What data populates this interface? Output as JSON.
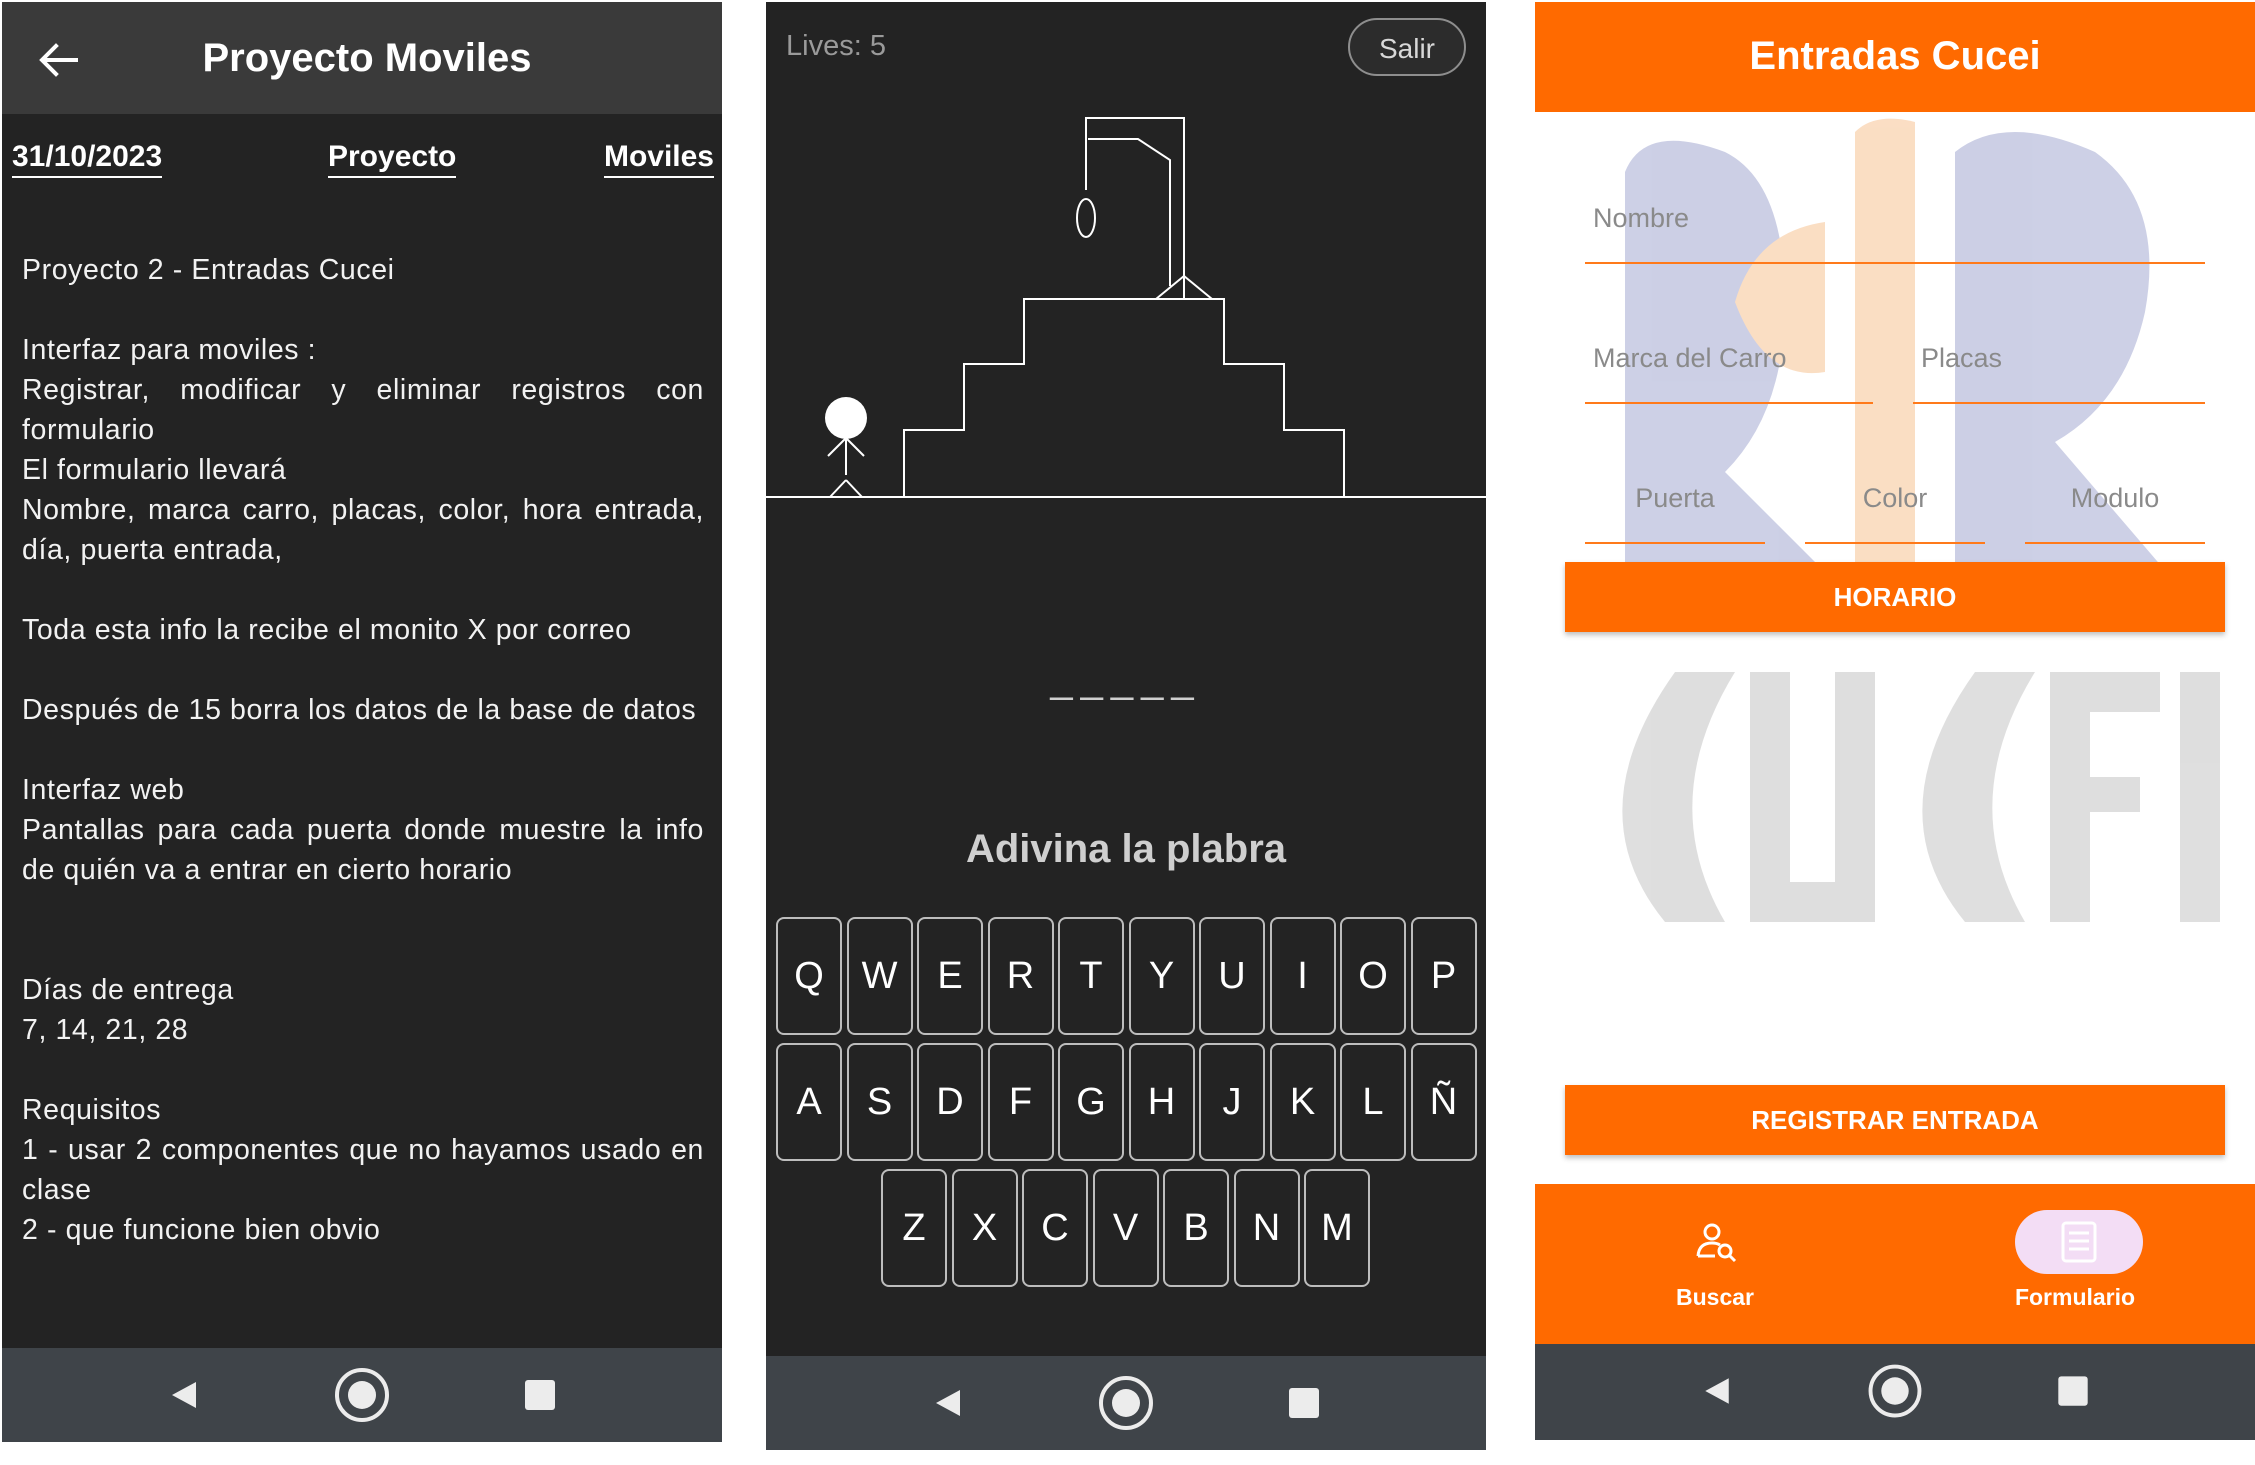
{
  "screen1": {
    "title": "Proyecto Moviles",
    "tabs": [
      "31/10/2023",
      "Proyecto",
      "Moviles"
    ],
    "body": {
      "l1": "Proyecto 2 - Entradas Cucei",
      "l2": "Interfaz para moviles :",
      "l3": "Registrar, modificar y eliminar registros con formulario",
      "l4": "El formulario llevará",
      "l5": "Nombre, marca carro, placas, color, hora entrada, día, puerta entrada,",
      "l6": "Toda esta info la recibe el monito X por correo",
      "l7": "Después de 15 borra los datos de la base de datos",
      "l8": "Interfaz web",
      "l9": "Pantallas para cada puerta donde muestre la info de quién va a entrar en cierto horario",
      "l10": "Días de entrega",
      "l11": "7, 14, 21, 28",
      "l12": "Requisitos",
      "l13": "1 - usar 2 componentes que no hayamos usado en clase",
      "l14": "2 - que funcione bien obvio"
    }
  },
  "screen2": {
    "lives": "Lives: 5",
    "exit_label": "Salir",
    "word_blanks": "_____",
    "prompt": "Adivina la plabra",
    "keyboard": {
      "row1": [
        "Q",
        "W",
        "E",
        "R",
        "T",
        "Y",
        "U",
        "I",
        "O",
        "P"
      ],
      "row2": [
        "A",
        "S",
        "D",
        "F",
        "G",
        "H",
        "J",
        "K",
        "L",
        "Ñ"
      ],
      "row3": [
        "Z",
        "X",
        "C",
        "V",
        "B",
        "N",
        "M"
      ]
    }
  },
  "screen3": {
    "title": "Entradas Cucei",
    "fields": {
      "nombre": "Nombre",
      "marca": "Marca del Carro",
      "placas": "Placas",
      "puerta": "Puerta",
      "color": "Color",
      "modulo": "Modulo"
    },
    "horario_button": "HORARIO",
    "register_button": "REGISTRAR ENTRADA",
    "bottom_nav": {
      "buscar": "Buscar",
      "formulario": "Formulario"
    },
    "accent_color": "#ff6a00",
    "watermark_text": "CUCEI"
  },
  "icons": {
    "back": "arrow-left-icon",
    "nav_back": "triangle-back-icon",
    "nav_home": "circle-home-icon",
    "nav_recent": "square-recents-icon",
    "buscar": "person-search-icon",
    "formulario": "document-list-icon"
  }
}
